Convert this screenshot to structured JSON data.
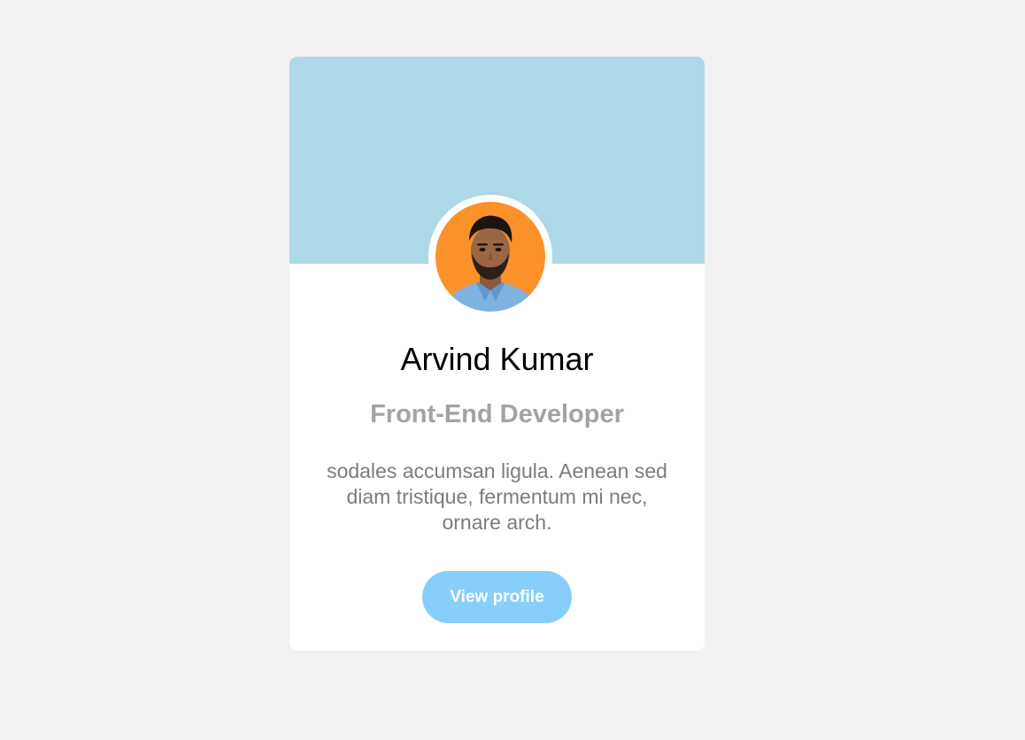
{
  "profile_card": {
    "name": "Arvind Kumar",
    "role": "Front-End Developer",
    "bio": "sodales accumsan ligula. Aenean sed diam tristique, fermentum mi nec, ornare arch.",
    "button_label": "View profile",
    "avatar_icon": "person-photo-icon"
  },
  "colors": {
    "page_background": "#f1f1f1",
    "banner": "#add8e6",
    "avatar_background": "#fb9129",
    "button": "#87cefa",
    "role_text": "#a3a3a3",
    "bio_text": "#7c7c7c"
  }
}
